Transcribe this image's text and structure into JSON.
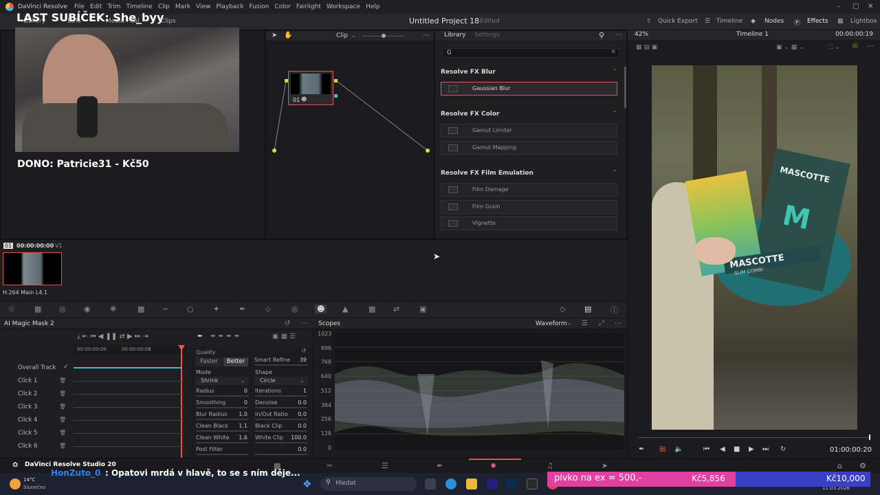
{
  "app": {
    "name": "DaVinci Resolve",
    "project_title": "Untitled Project 18",
    "status": "Edited"
  },
  "menu": [
    "File",
    "Edit",
    "Trim",
    "Timeline",
    "Clip",
    "Mark",
    "View",
    "Playback",
    "Fusion",
    "Color",
    "Fairlight",
    "Workspace",
    "Help"
  ],
  "toolbar": {
    "left": [
      "Gallery",
      "LUTs",
      "Media Pool",
      "Clips"
    ],
    "right": [
      "Quick Export",
      "Timeline",
      "Nodes",
      "Effects",
      "Lightbox"
    ]
  },
  "stream_overlay": {
    "last_sub": "LAST SUBÍČEK: She_byy",
    "dono": "DONO: Patricie31 - Kč50",
    "chat_user": "HonZuto_0",
    "chat_message": ": Opatovi mrdá v hlavě, to se s ním děje...",
    "goal_text": "pivko na ex = 500,-",
    "goal_amount": "Kč5,856",
    "goal2_amount": "Kč10,000",
    "app_badge": "DaVinci Resolve Studio 20"
  },
  "node_editor": {
    "dropdown": "Clip",
    "node_label": "01"
  },
  "library": {
    "tabs": [
      "Library",
      "Settings"
    ],
    "search_value": "G",
    "sections": [
      {
        "title": "Resolve FX Blur",
        "items": [
          "Gaussian Blur"
        ]
      },
      {
        "title": "Resolve FX Color",
        "items": [
          "Gamut Limiter",
          "Gamut Mapping"
        ]
      },
      {
        "title": "Resolve FX Film Emulation",
        "items": [
          "Film Damage",
          "Film Grain",
          "Vignette"
        ]
      }
    ]
  },
  "viewer": {
    "zoom": "42%",
    "timeline": "Timeline 1",
    "timecode_top": "00:00:00:19",
    "timecode_bottom": "01:00:00:20"
  },
  "clips": {
    "index": "01",
    "timecode": "00:00:00:00",
    "track": "V1",
    "codec": "H.264 Main L4.1"
  },
  "magic_mask": {
    "title": "AI Magic Mask 2",
    "ruler": [
      "00:00:00:00",
      "00:00:00:08"
    ],
    "tracks": [
      "Overall Track",
      "Click 1",
      "Click 2",
      "Click 3",
      "Click 4",
      "Click 5",
      "Click 6"
    ]
  },
  "quality": {
    "title": "Quality",
    "faster": "Faster",
    "better": "Better",
    "smart_refine_label": "Smart Refine",
    "smart_refine_value": "39",
    "mode_label": "Mode",
    "mode_value": "Shrink",
    "shape_label": "Shape",
    "shape_value": "Circle",
    "rows": [
      {
        "l1": "Radius",
        "v1": "0",
        "l2": "Iterations",
        "v2": "1"
      },
      {
        "l1": "Smoothing",
        "v1": "0",
        "l2": "Denoise",
        "v2": "0.0"
      },
      {
        "l1": "Blur Radius",
        "v1": "1.0",
        "l2": "In/Out Ratio",
        "v2": "0.0"
      },
      {
        "l1": "Clean Black",
        "v1": "1.1",
        "l2": "Black Clip",
        "v2": "0.0"
      },
      {
        "l1": "Clean White",
        "v1": "1.6",
        "l2": "White Clip",
        "v2": "100.0"
      },
      {
        "l1": "Post Filter",
        "v1": "",
        "l2": "",
        "v2": "0.0"
      }
    ]
  },
  "scopes": {
    "title": "Scopes",
    "mode": "Waveform",
    "y_labels": [
      "1023",
      "896",
      "768",
      "640",
      "512",
      "384",
      "256",
      "128",
      "0"
    ]
  },
  "taskbar": {
    "search_placeholder": "Hledat",
    "weather_temp": "14°C",
    "weather_desc": "Slunečno",
    "date": "11.03.2026"
  },
  "video_text": {
    "brand": "MASCOTTE",
    "sub": "SLIM COMBI"
  }
}
